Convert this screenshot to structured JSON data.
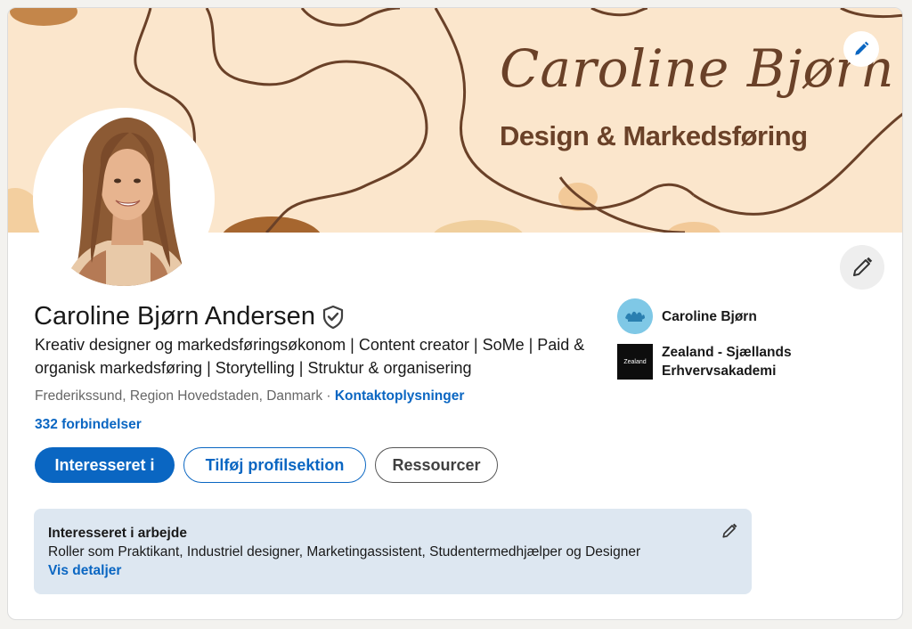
{
  "banner": {
    "title": "Caroline Bjørn",
    "subtitle": "Design & Markedsføring",
    "edit_icon": "pencil-icon",
    "colors": {
      "background": "#fbe6cc",
      "lines": "#6a4128",
      "accent": "#a6662f"
    }
  },
  "profile": {
    "name": "Caroline Bjørn Andersen",
    "verified_icon": "shield-check-icon",
    "headline": "Kreativ designer og markedsføringsøkonom | Content creator | SoMe | Paid & organisk markedsføring | Storytelling | Struktur & organisering",
    "location": "Frederikssund, Region Hovedstaden, Danmark",
    "separator": " · ",
    "contact_link": "Kontaktoplysninger",
    "connections": "332 forbindelser"
  },
  "actions": {
    "primary": "Interesseret i",
    "secondary": "Tilføj profilsektion",
    "outline": "Ressourcer"
  },
  "experience": [
    {
      "label": "Caroline Bjørn",
      "logo": "round-logo"
    },
    {
      "label": "Zealand - Sjællands Erhvervsakademi",
      "logo_text": "Zealand"
    }
  ],
  "open_to_work": {
    "title": "Interesseret i arbejde",
    "text": "Roller som Praktikant, Industriel designer, Marketingassistent, Studentermedhjælper og Designer",
    "link": "Vis detaljer",
    "edit_icon": "pencil-icon"
  },
  "colors": {
    "brand": "#0a66c2",
    "card_bg": "#dde7f1"
  }
}
